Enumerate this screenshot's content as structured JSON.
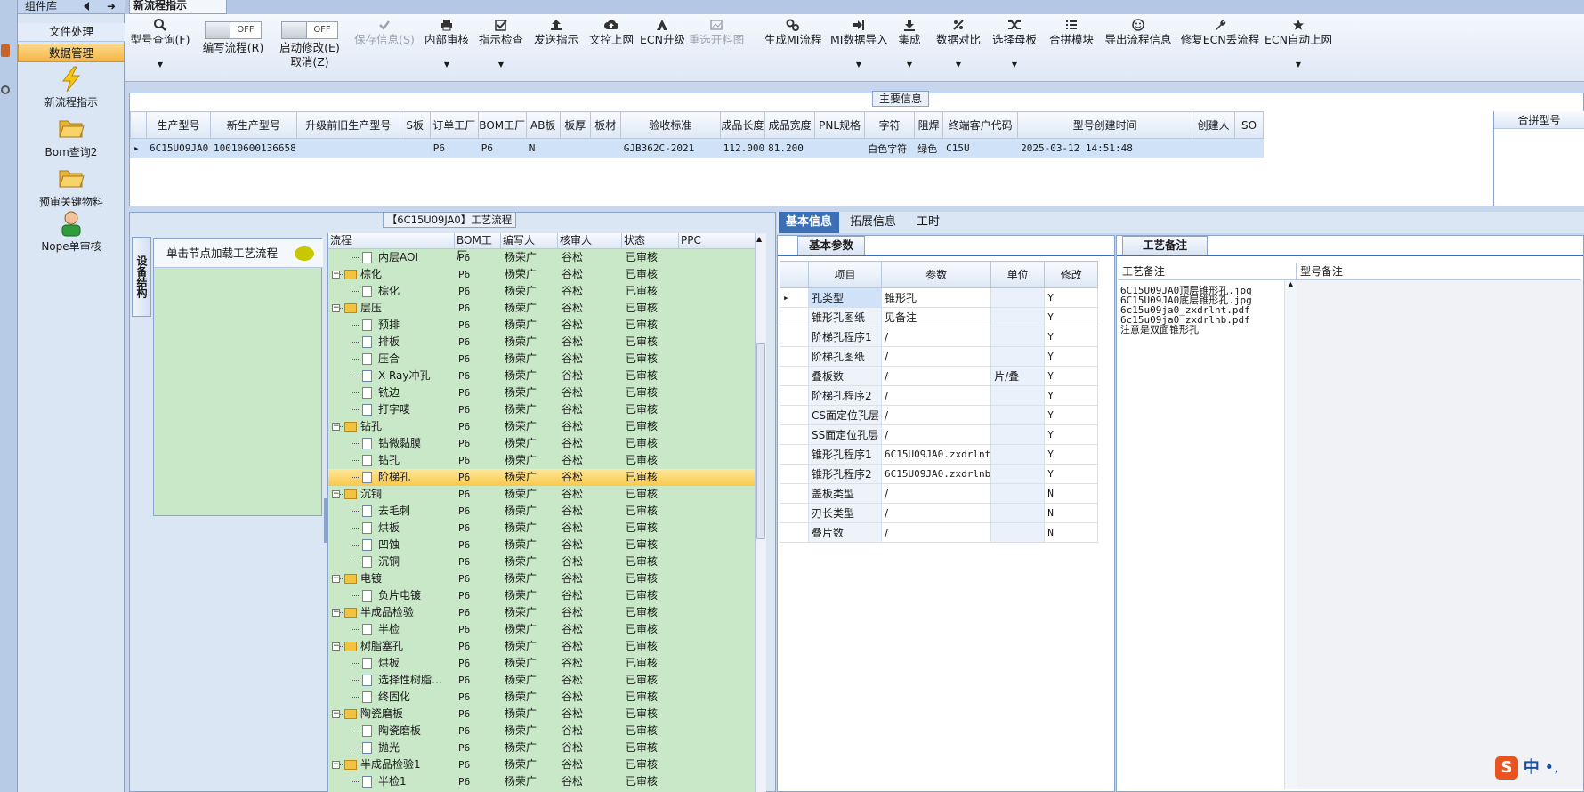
{
  "sidebar": {
    "header": "组件库",
    "categories": [
      "文件处理",
      "数据管理"
    ],
    "items": [
      {
        "label": "新流程指示",
        "icon": "lightning-icon"
      },
      {
        "label": "Bom查询2",
        "icon": "folder-open-icon"
      },
      {
        "label": "预审关键物料",
        "icon": "folder-open-icon"
      },
      {
        "label": "Nope单审核",
        "icon": "user-icon"
      }
    ]
  },
  "document_tab": "新流程指示",
  "toolbar": {
    "items": [
      {
        "label": "型号查询(F)",
        "icon": "search-icon",
        "dropdown": true
      },
      {
        "label": "编写流程(R)",
        "type": "toggle",
        "state": "OFF"
      },
      {
        "label": "启动修改(E)",
        "label2": "取消(Z)",
        "type": "toggle",
        "state": "OFF"
      },
      {
        "label": "保存信息(S)",
        "icon": "check-icon",
        "disabled": true
      },
      {
        "label": "内部审核",
        "icon": "printer-icon",
        "dropdown": true
      },
      {
        "label": "指示检查",
        "icon": "checkbox-icon",
        "dropdown": true
      },
      {
        "label": "发送指示",
        "icon": "upload-icon"
      },
      {
        "label": "文控上网",
        "icon": "cloud-upload-icon"
      },
      {
        "label": "ECN升级",
        "icon": "ecn-icon"
      },
      {
        "label": "重选开料图",
        "icon": "image-icon",
        "disabled": true
      },
      {
        "label": "生成MI流程",
        "icon": "gears-icon"
      },
      {
        "label": "MI数据导入",
        "icon": "import-icon",
        "dropdown": true
      },
      {
        "label": "集成",
        "icon": "download-icon",
        "dropdown": true
      },
      {
        "label": "数据对比",
        "icon": "compare-icon",
        "dropdown": true
      },
      {
        "label": "选择母板",
        "icon": "shuffle-icon",
        "dropdown": true
      },
      {
        "label": "合拼模块",
        "icon": "list-icon"
      },
      {
        "label": "导出流程信息",
        "icon": "smile-icon"
      },
      {
        "label": "修复ECN丢流程",
        "icon": "wrench-icon"
      },
      {
        "label": "ECN自动上网",
        "icon": "star-icon",
        "dropdown": true
      }
    ]
  },
  "main_info": {
    "title": "主要信息",
    "columns": [
      "生产型号",
      "新生产型号",
      "升级前旧生产型号",
      "S板",
      "订单工厂",
      "BOM工厂",
      "AB板",
      "板厚",
      "板材",
      "验收标准",
      "成品长度",
      "成品宽度",
      "PNL规格",
      "字符",
      "阻焊",
      "终端客户代码",
      "型号创建时间",
      "创建人",
      "SO"
    ],
    "row": [
      "6C15U09JA0",
      "10010600136658",
      "",
      "",
      "P6",
      "P6",
      "N",
      "",
      "",
      "GJB362C-2021",
      "112.000",
      "81.200",
      "",
      "白色字符",
      "绿色",
      "C15U",
      "2025-03-12 14:51:48",
      "",
      ""
    ],
    "side_header": "合拼型号"
  },
  "process": {
    "title": "【6C15U09JA0】工艺流程",
    "vertical_tab": "设备结构",
    "node_hint": "单击节点加载工艺流程",
    "columns": [
      "流程",
      "BOM工厂",
      "编写人",
      "核审人",
      "状态",
      "PPC"
    ],
    "rows": [
      {
        "name": "内层AOI",
        "level": 1,
        "bom": "P6",
        "writer": "杨荣广",
        "reviewer": "谷松",
        "status": "已审核"
      },
      {
        "name": "棕化",
        "level": 0,
        "bom": "P6",
        "writer": "杨荣广",
        "reviewer": "谷松",
        "status": "已审核"
      },
      {
        "name": "棕化",
        "level": 1,
        "bom": "P6",
        "writer": "杨荣广",
        "reviewer": "谷松",
        "status": "已审核"
      },
      {
        "name": "层压",
        "level": 0,
        "bom": "P6",
        "writer": "杨荣广",
        "reviewer": "谷松",
        "status": "已审核"
      },
      {
        "name": "预排",
        "level": 1,
        "bom": "P6",
        "writer": "杨荣广",
        "reviewer": "谷松",
        "status": "已审核"
      },
      {
        "name": "排板",
        "level": 1,
        "bom": "P6",
        "writer": "杨荣广",
        "reviewer": "谷松",
        "status": "已审核"
      },
      {
        "name": "压合",
        "level": 1,
        "bom": "P6",
        "writer": "杨荣广",
        "reviewer": "谷松",
        "status": "已审核"
      },
      {
        "name": "X-Ray冲孔",
        "level": 1,
        "bom": "P6",
        "writer": "杨荣广",
        "reviewer": "谷松",
        "status": "已审核"
      },
      {
        "name": "铣边",
        "level": 1,
        "bom": "P6",
        "writer": "杨荣广",
        "reviewer": "谷松",
        "status": "已审核"
      },
      {
        "name": "打字唛",
        "level": 1,
        "bom": "P6",
        "writer": "杨荣广",
        "reviewer": "谷松",
        "status": "已审核"
      },
      {
        "name": "钻孔",
        "level": 0,
        "bom": "P6",
        "writer": "杨荣广",
        "reviewer": "谷松",
        "status": "已审核"
      },
      {
        "name": "钻微黏膜",
        "level": 1,
        "bom": "P6",
        "writer": "杨荣广",
        "reviewer": "谷松",
        "status": "已审核"
      },
      {
        "name": "钻孔",
        "level": 1,
        "bom": "P6",
        "writer": "杨荣广",
        "reviewer": "谷松",
        "status": "已审核"
      },
      {
        "name": "阶梯孔",
        "level": 1,
        "bom": "P6",
        "writer": "杨荣广",
        "reviewer": "谷松",
        "status": "已审核",
        "selected": true
      },
      {
        "name": "沉铜",
        "level": 0,
        "bom": "P6",
        "writer": "杨荣广",
        "reviewer": "谷松",
        "status": "已审核"
      },
      {
        "name": "去毛刺",
        "level": 1,
        "bom": "P6",
        "writer": "杨荣广",
        "reviewer": "谷松",
        "status": "已审核"
      },
      {
        "name": "烘板",
        "level": 1,
        "bom": "P6",
        "writer": "杨荣广",
        "reviewer": "谷松",
        "status": "已审核"
      },
      {
        "name": "凹蚀",
        "level": 1,
        "bom": "P6",
        "writer": "杨荣广",
        "reviewer": "谷松",
        "status": "已审核"
      },
      {
        "name": "沉铜",
        "level": 1,
        "bom": "P6",
        "writer": "杨荣广",
        "reviewer": "谷松",
        "status": "已审核"
      },
      {
        "name": "电镀",
        "level": 0,
        "bom": "P6",
        "writer": "杨荣广",
        "reviewer": "谷松",
        "status": "已审核"
      },
      {
        "name": "负片电镀",
        "level": 1,
        "bom": "P6",
        "writer": "杨荣广",
        "reviewer": "谷松",
        "status": "已审核"
      },
      {
        "name": "半成品检验",
        "level": 0,
        "bom": "P6",
        "writer": "杨荣广",
        "reviewer": "谷松",
        "status": "已审核"
      },
      {
        "name": "半检",
        "level": 1,
        "bom": "P6",
        "writer": "杨荣广",
        "reviewer": "谷松",
        "status": "已审核"
      },
      {
        "name": "树脂塞孔",
        "level": 0,
        "bom": "P6",
        "writer": "杨荣广",
        "reviewer": "谷松",
        "status": "已审核"
      },
      {
        "name": "烘板",
        "level": 1,
        "bom": "P6",
        "writer": "杨荣广",
        "reviewer": "谷松",
        "status": "已审核"
      },
      {
        "name": "选择性树脂…",
        "level": 1,
        "bom": "P6",
        "writer": "杨荣广",
        "reviewer": "谷松",
        "status": "已审核"
      },
      {
        "name": "终固化",
        "level": 1,
        "bom": "P6",
        "writer": "杨荣广",
        "reviewer": "谷松",
        "status": "已审核"
      },
      {
        "name": "陶瓷磨板",
        "level": 0,
        "bom": "P6",
        "writer": "杨荣广",
        "reviewer": "谷松",
        "status": "已审核"
      },
      {
        "name": "陶瓷磨板",
        "level": 1,
        "bom": "P6",
        "writer": "杨荣广",
        "reviewer": "谷松",
        "status": "已审核"
      },
      {
        "name": "抛光",
        "level": 1,
        "bom": "P6",
        "writer": "杨荣广",
        "reviewer": "谷松",
        "status": "已审核"
      },
      {
        "name": "半成品检验1",
        "level": 0,
        "bom": "P6",
        "writer": "杨荣广",
        "reviewer": "谷松",
        "status": "已审核"
      },
      {
        "name": "半检1",
        "level": 1,
        "bom": "P6",
        "writer": "杨荣广",
        "reviewer": "谷松",
        "status": "已审核"
      }
    ]
  },
  "right_tabs": [
    "基本信息",
    "拓展信息",
    "工时"
  ],
  "basic_params": {
    "tab": "基本参数",
    "columns": [
      "项目",
      "参数",
      "单位",
      "修改"
    ],
    "rows": [
      [
        "孔类型",
        "锥形孔",
        "",
        "Y"
      ],
      [
        "锥形孔图纸",
        "见备注",
        "",
        "Y"
      ],
      [
        "阶梯孔程序1",
        "/",
        "",
        "Y"
      ],
      [
        "阶梯孔图纸",
        "/",
        "",
        "Y"
      ],
      [
        "叠板数",
        "/",
        "片/叠",
        "Y"
      ],
      [
        "阶梯孔程序2",
        "/",
        "",
        "Y"
      ],
      [
        "CS面定位孔层",
        "/",
        "",
        "Y"
      ],
      [
        "SS面定位孔层",
        "/",
        "",
        "Y"
      ],
      [
        "锥形孔程序1",
        "6C15U09JA0.zxdrlnt",
        "",
        "Y"
      ],
      [
        "锥形孔程序2",
        "6C15U09JA0.zxdrlnb",
        "",
        "Y"
      ],
      [
        "盖板类型",
        "/",
        "",
        "N"
      ],
      [
        "刃长类型",
        "/",
        "",
        "N"
      ],
      [
        "叠片数",
        "/",
        "",
        "N"
      ]
    ]
  },
  "process_notes": {
    "tab": "工艺备注",
    "col1": "工艺备注",
    "col2": "型号备注",
    "lines": [
      "6C15U09JA0顶层锥形孔.jpg",
      "6C15U09JA0底层锥形孔.jpg",
      "6c15u09ja0_zxdrlnt.pdf",
      "6c15u09ja0_zxdrlnb.pdf",
      "注意是双面锥形孔"
    ]
  },
  "ime": {
    "label": "中"
  }
}
